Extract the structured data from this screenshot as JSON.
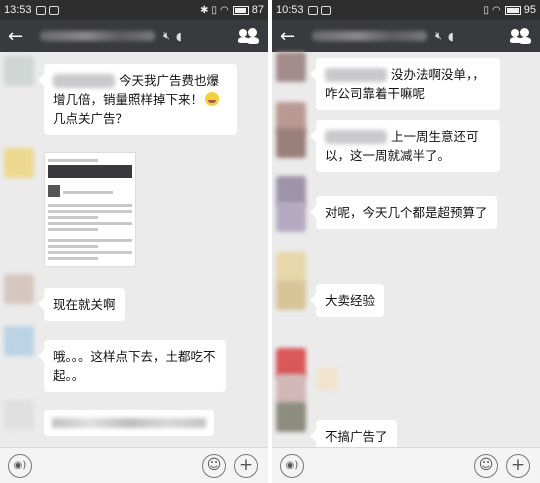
{
  "left": {
    "status": {
      "time": "13:53",
      "battery": "87"
    },
    "messages": {
      "m1": "今天我广告费也爆增几倍，销量照样掉下来！",
      "m1b": "几点关广告？",
      "m2": "现在就关啊",
      "m3": "哦。。。这样点下去，土都吃不起。。"
    }
  },
  "right": {
    "status": {
      "time": "10:53",
      "battery": "95"
    },
    "messages": {
      "m1": "没办法啊没单，，咋公司靠着干嘛呢",
      "m2": "上一周生意还可以，这一周就减半了。",
      "m3": "对呢，今天几个都是超预算了",
      "m4": "大卖经验",
      "m5": "不搞广告了"
    }
  },
  "icons": {
    "back": "←",
    "voice": "◉)",
    "smile": "☺",
    "plus": "+"
  }
}
